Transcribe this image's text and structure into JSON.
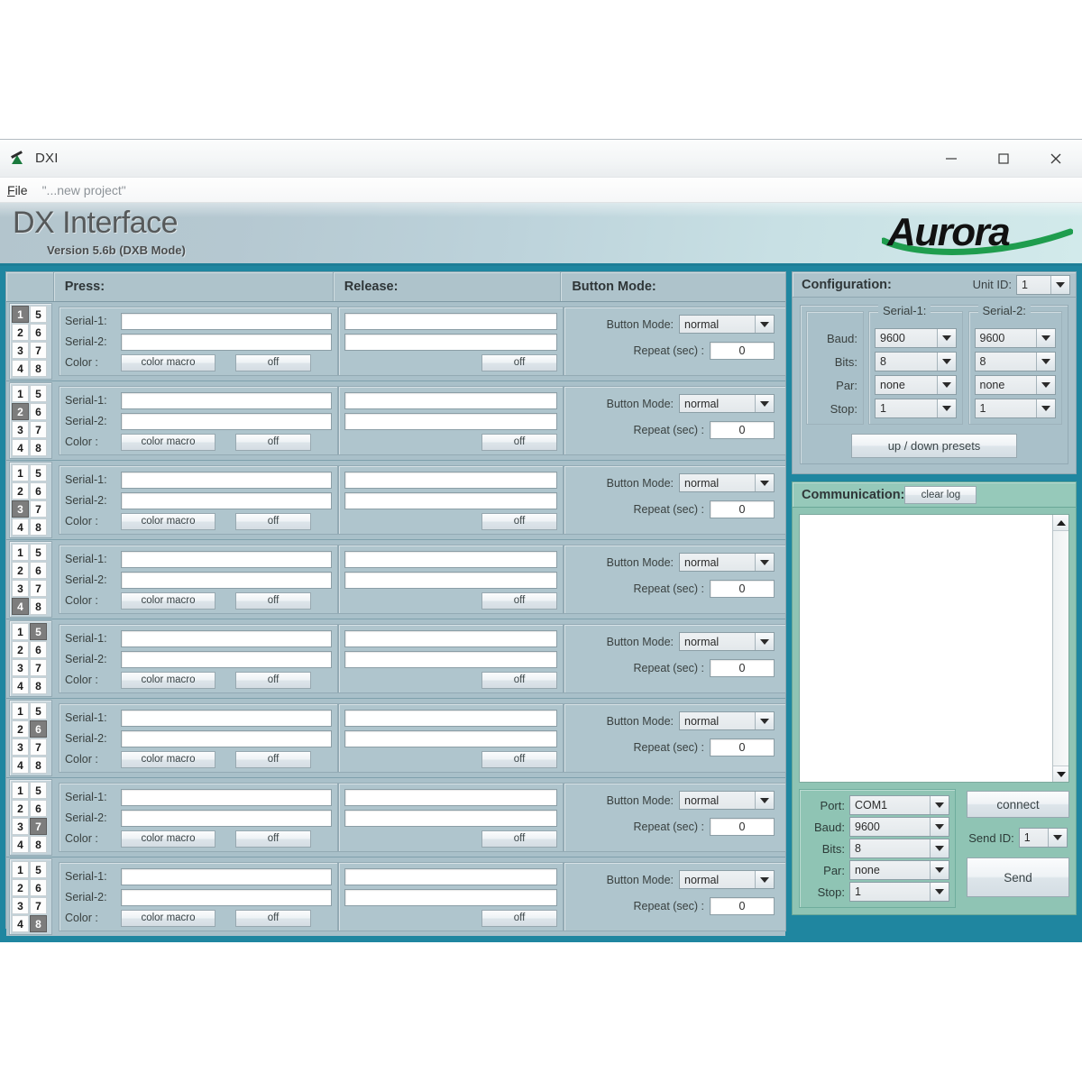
{
  "window": {
    "title": "DXI",
    "icon": "app-icon",
    "minimize": "minimize-icon",
    "maximize": "maximize-icon",
    "close": "close-icon"
  },
  "menubar": {
    "file": "File",
    "project": "\"...new project\""
  },
  "banner": {
    "title": "DX Interface",
    "subtitle": "Version 5.6b (DXB Mode)",
    "logo_text": "Aurora",
    "logo_accent": "#1f9d4e"
  },
  "columns": {
    "blank": "",
    "press": "Press:",
    "release": "Release:",
    "button_mode": "Button Mode:"
  },
  "labels": {
    "serial1": "Serial-1:",
    "serial2": "Serial-2:",
    "color": "Color :",
    "color_macro": "color macro",
    "off": "off",
    "button_mode": "Button Mode:",
    "repeat": "Repeat (sec) :"
  },
  "rows": [
    {
      "selected": 1,
      "keys": [
        [
          "1",
          "5"
        ],
        [
          "2",
          "6"
        ],
        [
          "3",
          "7"
        ],
        [
          "4",
          "8"
        ]
      ],
      "press_serial1": "",
      "press_serial2": "",
      "release_serial1": "",
      "release_serial2": "",
      "mode": "normal",
      "repeat": "0"
    },
    {
      "selected": 2,
      "keys": [
        [
          "1",
          "5"
        ],
        [
          "2",
          "6"
        ],
        [
          "3",
          "7"
        ],
        [
          "4",
          "8"
        ]
      ],
      "press_serial1": "",
      "press_serial2": "",
      "release_serial1": "",
      "release_serial2": "",
      "mode": "normal",
      "repeat": "0"
    },
    {
      "selected": 3,
      "keys": [
        [
          "1",
          "5"
        ],
        [
          "2",
          "6"
        ],
        [
          "3",
          "7"
        ],
        [
          "4",
          "8"
        ]
      ],
      "press_serial1": "",
      "press_serial2": "",
      "release_serial1": "",
      "release_serial2": "",
      "mode": "normal",
      "repeat": "0"
    },
    {
      "selected": 4,
      "keys": [
        [
          "1",
          "5"
        ],
        [
          "2",
          "6"
        ],
        [
          "3",
          "7"
        ],
        [
          "4",
          "8"
        ]
      ],
      "press_serial1": "",
      "press_serial2": "",
      "release_serial1": "",
      "release_serial2": "",
      "mode": "normal",
      "repeat": "0"
    },
    {
      "selected": 5,
      "keys": [
        [
          "1",
          "5"
        ],
        [
          "2",
          "6"
        ],
        [
          "3",
          "7"
        ],
        [
          "4",
          "8"
        ]
      ],
      "press_serial1": "",
      "press_serial2": "",
      "release_serial1": "",
      "release_serial2": "",
      "mode": "normal",
      "repeat": "0"
    },
    {
      "selected": 6,
      "keys": [
        [
          "1",
          "5"
        ],
        [
          "2",
          "6"
        ],
        [
          "3",
          "7"
        ],
        [
          "4",
          "8"
        ]
      ],
      "press_serial1": "",
      "press_serial2": "",
      "release_serial1": "",
      "release_serial2": "",
      "mode": "normal",
      "repeat": "0"
    },
    {
      "selected": 7,
      "keys": [
        [
          "1",
          "5"
        ],
        [
          "2",
          "6"
        ],
        [
          "3",
          "7"
        ],
        [
          "4",
          "8"
        ]
      ],
      "press_serial1": "",
      "press_serial2": "",
      "release_serial1": "",
      "release_serial2": "",
      "mode": "normal",
      "repeat": "0"
    },
    {
      "selected": 8,
      "keys": [
        [
          "1",
          "5"
        ],
        [
          "2",
          "6"
        ],
        [
          "3",
          "7"
        ],
        [
          "4",
          "8"
        ]
      ],
      "press_serial1": "",
      "press_serial2": "",
      "release_serial1": "",
      "release_serial2": "",
      "mode": "normal",
      "repeat": "0"
    }
  ],
  "configuration": {
    "title": "Configuration:",
    "unit_id_label": "Unit ID:",
    "unit_id_value": "1",
    "serial1_legend": "Serial-1:",
    "serial2_legend": "Serial-2:",
    "row_labels": [
      "Baud:",
      "Bits:",
      "Par:",
      "Stop:"
    ],
    "serial1_values": [
      "9600",
      "8",
      "none",
      "1"
    ],
    "serial2_values": [
      "9600",
      "8",
      "none",
      "1"
    ],
    "presets_button": "up / down presets"
  },
  "communication": {
    "title": "Communication:",
    "clear_log": "clear log",
    "log_text": "",
    "port_label": "Port:",
    "port_value": "COM1",
    "baud_label": "Baud:",
    "baud_value": "9600",
    "bits_label": "Bits:",
    "bits_value": "8",
    "par_label": "Par:",
    "par_value": "none",
    "stop_label": "Stop:",
    "stop_value": "1",
    "connect": "connect",
    "send_id_label": "Send ID:",
    "send_id_value": "1",
    "send": "Send"
  },
  "theme": {
    "teal_border": "#1f86a0",
    "panel_bg": "#a9c0c9",
    "comm_bg": "#8fc4b4"
  }
}
